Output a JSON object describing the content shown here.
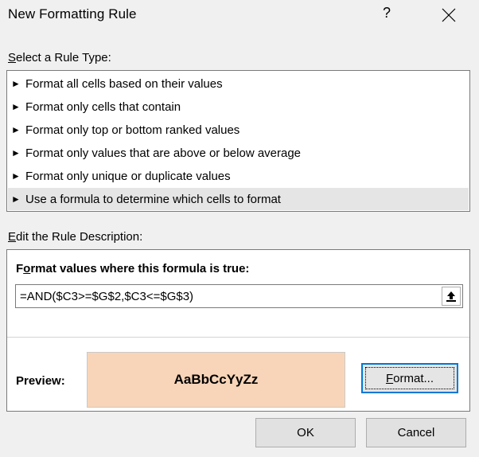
{
  "window": {
    "title": "New Formatting Rule",
    "help_glyph": "?",
    "close_icon": "close-icon"
  },
  "rule_type": {
    "label_accel": "S",
    "label_rest": "elect a Rule Type:",
    "arrow_glyph": "►",
    "items": [
      {
        "label": "Format all cells based on their values",
        "selected": false
      },
      {
        "label": "Format only cells that contain",
        "selected": false
      },
      {
        "label": "Format only top or bottom ranked values",
        "selected": false
      },
      {
        "label": "Format only values that are above or below average",
        "selected": false
      },
      {
        "label": "Format only unique or duplicate values",
        "selected": false
      },
      {
        "label": "Use a formula to determine which cells to format",
        "selected": true
      }
    ]
  },
  "description": {
    "label_accel": "E",
    "label_rest": "dit the Rule Description:",
    "formula_label_pre": "F",
    "formula_label_accel": "o",
    "formula_label_rest": "rmat values where this formula is true:",
    "formula_value": "=AND($C3>=$G$2,$C3<=$G$3)",
    "collapse_icon": "collapse-dialog-icon",
    "preview_label": "Preview:",
    "preview_text": "AaBbCcYyZz",
    "preview_fill": "#f8d5b8",
    "format_accel": "F",
    "format_rest": "ormat..."
  },
  "buttons": {
    "ok": "OK",
    "cancel": "Cancel"
  }
}
